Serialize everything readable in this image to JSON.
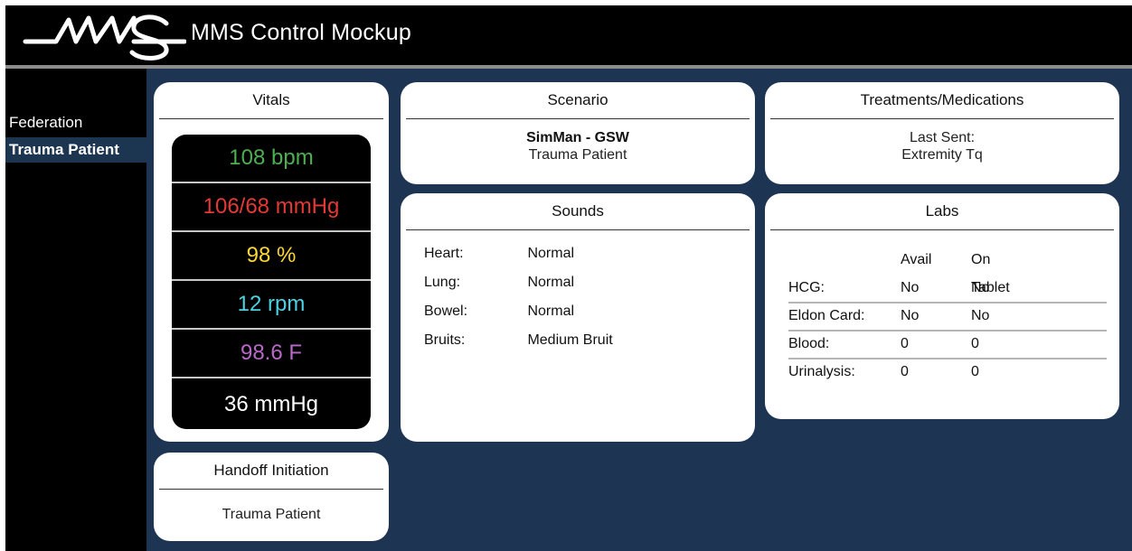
{
  "header": {
    "title": "MMS Control Mockup",
    "logo_text": "MMS"
  },
  "sidebar": {
    "items": [
      {
        "label": "Federation",
        "active": false
      },
      {
        "label": "Trauma Patient",
        "active": true
      }
    ]
  },
  "vitals": {
    "title": "Vitals",
    "readings": [
      {
        "text": "108 bpm",
        "color": "#4caf50"
      },
      {
        "text": "106/68 mmHg",
        "color": "#e53935"
      },
      {
        "text": "98 %",
        "color": "#fdd835"
      },
      {
        "text": "12 rpm",
        "color": "#4dd0e1"
      },
      {
        "text": "98.6 F",
        "color": "#ba68c8"
      },
      {
        "text": "36 mmHg",
        "color": "#ffffff"
      }
    ]
  },
  "handoff": {
    "title": "Handoff Initiation",
    "value": "Trauma Patient"
  },
  "scenario": {
    "title": "Scenario",
    "name": "SimMan - GSW",
    "subtitle": "Trauma Patient"
  },
  "sounds": {
    "title": "Sounds",
    "rows": [
      {
        "label": "Heart:",
        "value": "Normal"
      },
      {
        "label": "Lung:",
        "value": "Normal"
      },
      {
        "label": "Bowel:",
        "value": "Normal"
      },
      {
        "label": "Bruits:",
        "value": "Medium Bruit"
      }
    ]
  },
  "treatments": {
    "title": "Treatments/Medications",
    "label": "Last Sent:",
    "value": "Extremity Tq"
  },
  "labs": {
    "title": "Labs",
    "headers": [
      "",
      "Avail",
      "On Tablet"
    ],
    "rows": [
      {
        "name": "HCG:",
        "avail": "No",
        "tablet": "No"
      },
      {
        "name": "Eldon Card:",
        "avail": "No",
        "tablet": "No"
      },
      {
        "name": "Blood:",
        "avail": "0",
        "tablet": "0"
      },
      {
        "name": "Urinalysis:",
        "avail": "0",
        "tablet": "0"
      }
    ]
  },
  "colors": {
    "main_bg": "#1d3553",
    "header_bg": "#000000",
    "active_nav": "#1c3550"
  }
}
